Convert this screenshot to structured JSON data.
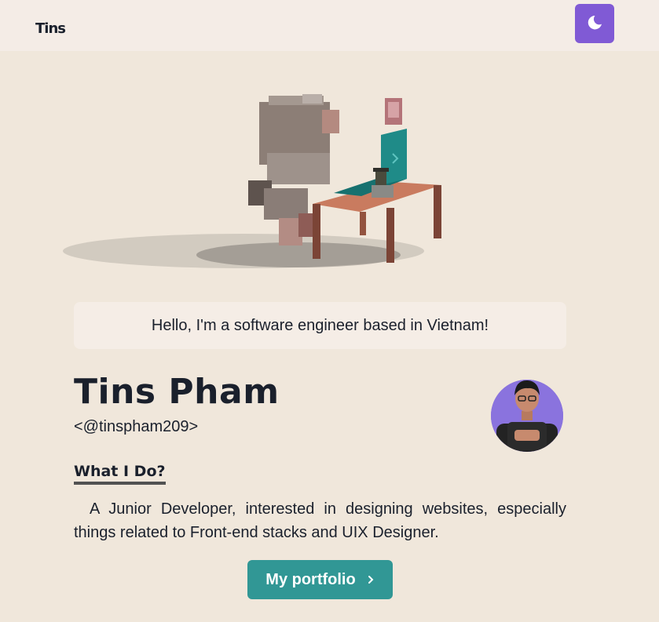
{
  "header": {
    "logo_text": "Tins",
    "theme_toggle_icon": "moon-icon"
  },
  "hero": {
    "image": "voxel-developer-at-desk-illustration"
  },
  "greeting": "Hello, I'm a software engineer based in Vietnam!",
  "profile": {
    "name": "Tins Pham",
    "handle": "<@tinspham209>",
    "avatar": "profile-avatar"
  },
  "work": {
    "heading": "What I Do?",
    "description": "A Junior Developer, interested in designing websites, especially things related to Front-end stacks and UIX Designer."
  },
  "cta": {
    "label": "My portfolio",
    "icon": "chevron-right-icon"
  },
  "colors": {
    "background": "#f0e7db",
    "navbar": "#f4ece6",
    "theme_toggle": "#805ad5",
    "button": "#319795",
    "text": "#1a202c"
  }
}
